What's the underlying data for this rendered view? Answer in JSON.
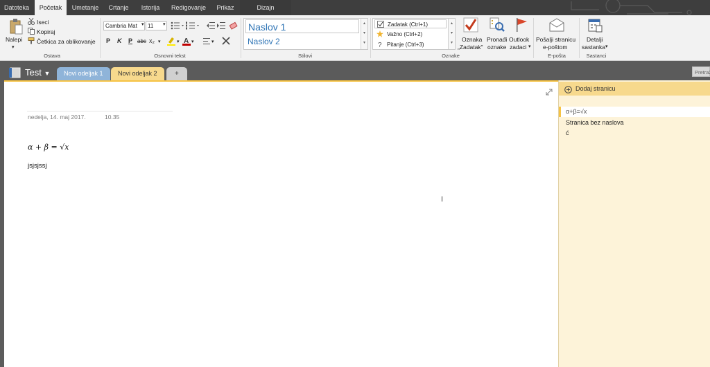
{
  "ribbon_tabs": [
    "Datoteka",
    "Početak",
    "Umetanje",
    "Crtanje",
    "Istorija",
    "Redigovanje",
    "Prikaz",
    "Dizajn"
  ],
  "clipboard": {
    "paste_label": "Nalepi",
    "cut_label": "Iseci",
    "copy_label": "Kopiraj",
    "format_painter_label": "Četkica za oblikovanje",
    "group_label": "Ostava"
  },
  "basic_text": {
    "font_name": "Cambria Mat",
    "font_size": "11",
    "bold": "P",
    "italic": "K",
    "underline": "P",
    "strike": "abc",
    "subscript": "x₂",
    "group_label": "Osnovni tekst"
  },
  "styles": {
    "items": [
      "Naslov 1",
      "Naslov 2"
    ],
    "group_label": "Stilovi"
  },
  "tags": {
    "items": [
      "Zadatak (Ctrl+1)",
      "Važno (Ctrl+2)",
      "Pitanje (Ctrl+3)"
    ],
    "todo_tag_label_1": "Oznaka",
    "todo_tag_label_2": "„Zadatak\"",
    "find_tags_label_1": "Pronađi",
    "find_tags_label_2": "oznake",
    "outlook_tasks_label_1": "Outlook",
    "outlook_tasks_label_2": "zadaci",
    "group_label": "Oznake"
  },
  "email": {
    "send_label_1": "Pošalji stranicu",
    "send_label_2": "e-poštom",
    "group_label": "E-pošta"
  },
  "meetings": {
    "details_label_1": "Detalji",
    "details_label_2": "sastanka",
    "group_label": "Sastanci"
  },
  "notebook": {
    "title": "Test",
    "sections": [
      "Novi odeljak 1",
      "Novi odeljak 2"
    ],
    "add_section": "+",
    "search_placeholder": "Pretraž"
  },
  "page": {
    "date": "nedelja, 14. maj 2017.",
    "time": "10.35",
    "formula": "α + β = √x",
    "body_text": "jsjsjssj"
  },
  "pages_panel": {
    "add_page_label": "Dodaj stranicu",
    "items": [
      "α+β=√x",
      "Stranica bez naslova",
      "ć"
    ]
  },
  "colors": {
    "accent": "#f6c344",
    "section1": "#8fb4d9",
    "section2": "#f7d98d",
    "heading": "#2e74b5"
  }
}
